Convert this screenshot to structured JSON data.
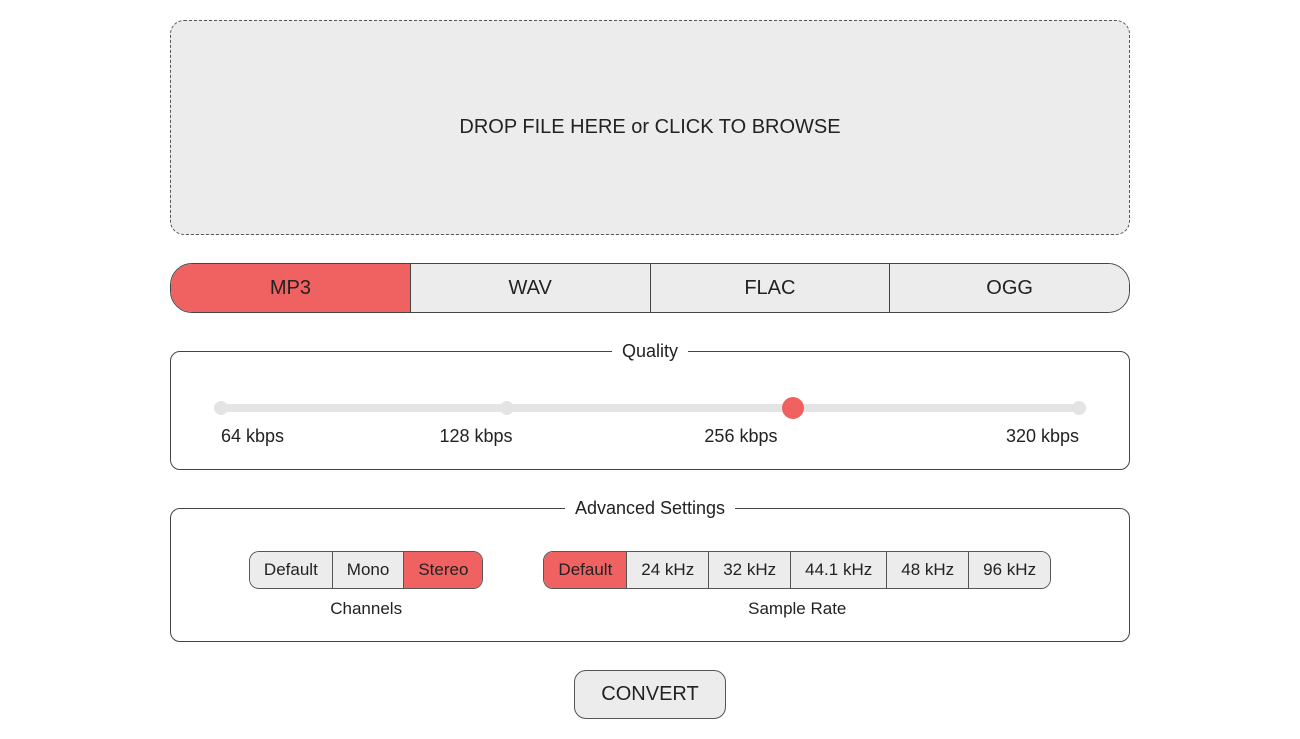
{
  "accent": "#f06262",
  "dropzone": {
    "text": "DROP FILE HERE or CLICK TO BROWSE"
  },
  "formats": {
    "options": [
      "MP3",
      "WAV",
      "FLAC",
      "OGG"
    ],
    "selected_index": 0
  },
  "quality": {
    "legend": "Quality",
    "stops": [
      "64 kbps",
      "128 kbps",
      "256 kbps",
      "320 kbps"
    ],
    "selected_index": 2
  },
  "advanced": {
    "legend": "Advanced Settings",
    "channels": {
      "caption": "Channels",
      "options": [
        "Default",
        "Mono",
        "Stereo"
      ],
      "selected_index": 2
    },
    "sample_rate": {
      "caption": "Sample Rate",
      "options": [
        "Default",
        "24 kHz",
        "32 kHz",
        "44.1 kHz",
        "48 kHz",
        "96 kHz"
      ],
      "selected_index": 0
    }
  },
  "convert": {
    "label": "CONVERT"
  }
}
